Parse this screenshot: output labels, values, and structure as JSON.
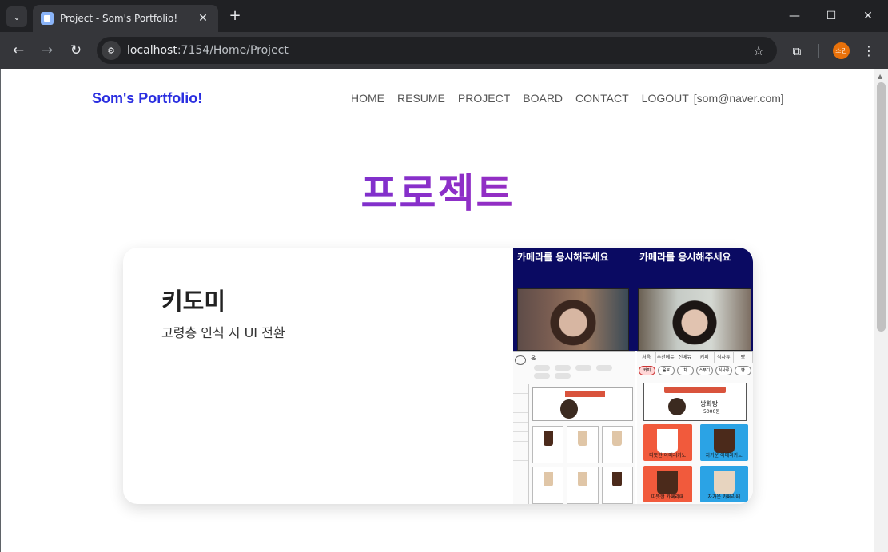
{
  "browser": {
    "tab_title": "Project - Som's Portfolio!",
    "url_host": "localhost",
    "url_path": ":7154/Home/Project",
    "profile_initials": "소민"
  },
  "site": {
    "brand": "Som's Portfolio!",
    "nav": [
      "HOME",
      "RESUME",
      "PROJECT",
      "BOARD",
      "CONTACT",
      "LOGOUT"
    ],
    "user_email": "[som@naver.com]"
  },
  "page": {
    "heading": "프로젝트"
  },
  "project": {
    "title": "키도미",
    "description": "고령층 인식 시 UI 전환",
    "image": {
      "banner_left": "카메라를 응시해주세요",
      "banner_right": "카메라를 응시해주세요",
      "kiosk_left_home": "홈",
      "kiosk_right_tabs": [
        "처음",
        "추천메뉴",
        "신메뉴",
        "커피",
        "식사류",
        "빵"
      ],
      "kiosk_right_pills": [
        "커피",
        "음료",
        "차",
        "스무디",
        "식사류",
        "빵"
      ],
      "kiosk_right_promo_name": "쌍화탕",
      "kiosk_right_promo_price": "5000원",
      "kiosk_right_items": [
        "따뜻한 아메리카노",
        "차가운 아메리카노",
        "따뜻한 카페라떼",
        "차가운 카페라떼"
      ]
    }
  },
  "colors": {
    "brand": "#2a2ee0",
    "heading_gradient": [
      "#4a34d8",
      "#8b2fc9",
      "#c32aa3"
    ],
    "banner": "#0a0a62"
  }
}
